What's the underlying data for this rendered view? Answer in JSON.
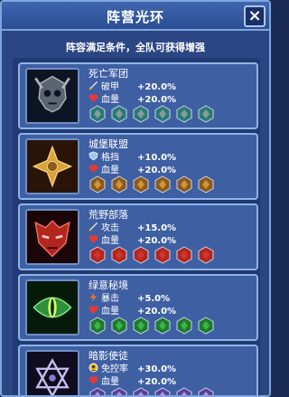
{
  "header": {
    "title": "阵营光环",
    "close_label": "×"
  },
  "subtitle": "阵容满足条件，全队可获得增强",
  "factions": [
    {
      "name": "死亡军团",
      "emblem": "skull-emblem-icon",
      "badge_icon": "undead-faction-icon",
      "badge_count": 6,
      "colors": {
        "accent": "#9aa0a6",
        "badge": "#2a7a73"
      },
      "stats": [
        {
          "icon": "sword-icon",
          "label": "破甲",
          "value": "+20.0%"
        },
        {
          "icon": "heart-icon",
          "label": "血量",
          "value": "+20.0%"
        }
      ]
    },
    {
      "name": "城堡联盟",
      "emblem": "cross-emblem-icon",
      "badge_icon": "castle-faction-icon",
      "badge_count": 6,
      "colors": {
        "accent": "#d9a23a",
        "badge": "#8a5a1f"
      },
      "stats": [
        {
          "icon": "shield-icon",
          "label": "格挡",
          "value": "+10.0%"
        },
        {
          "icon": "heart-icon",
          "label": "血量",
          "value": "+20.0%"
        }
      ]
    },
    {
      "name": "荒野部落",
      "emblem": "mask-emblem-icon",
      "badge_icon": "tribe-faction-icon",
      "badge_count": 6,
      "colors": {
        "accent": "#d23a32",
        "badge": "#b3261e"
      },
      "stats": [
        {
          "icon": "sword-icon",
          "label": "攻击",
          "value": "+15.0%"
        },
        {
          "icon": "heart-icon",
          "label": "血量",
          "value": "+20.0%"
        }
      ]
    },
    {
      "name": "绿意秘境",
      "emblem": "eye-emblem-icon",
      "badge_icon": "forest-faction-icon",
      "badge_count": 6,
      "colors": {
        "accent": "#3fbf4a",
        "badge": "#1f7a2f"
      },
      "stats": [
        {
          "icon": "lightning-icon",
          "label": "暴击",
          "value": "+5.0%"
        },
        {
          "icon": "heart-icon",
          "label": "血量",
          "value": "+20.0%"
        }
      ]
    },
    {
      "name": "暗影使徒",
      "emblem": "hexagram-emblem-icon",
      "badge_icon": "shadow-faction-icon",
      "badge_count": 6,
      "colors": {
        "accent": "#b8a8e8",
        "badge": "#5a3f9a"
      },
      "stats": [
        {
          "icon": "control-icon",
          "label": "免控率",
          "value": "+30.0%"
        },
        {
          "icon": "heart-icon",
          "label": "血量",
          "value": "+20.0%"
        }
      ]
    }
  ]
}
